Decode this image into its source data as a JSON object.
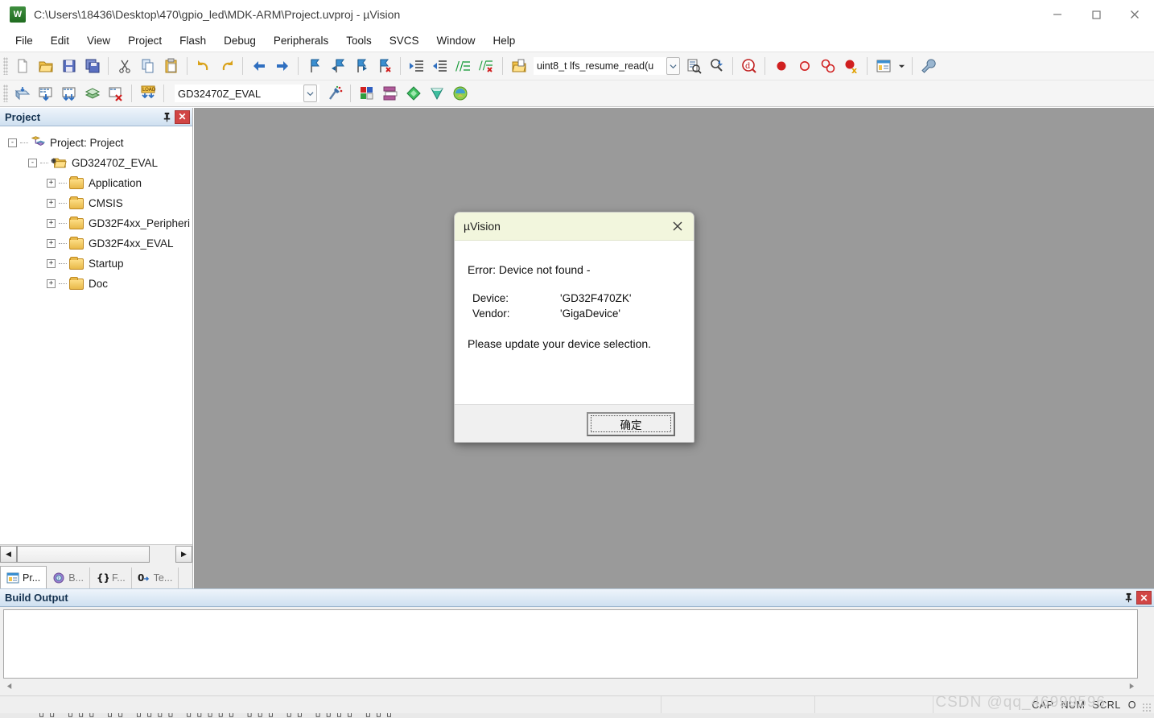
{
  "window": {
    "title": "C:\\Users\\18436\\Desktop\\470\\gpio_led\\MDK-ARM\\Project.uvproj - µVision",
    "app_icon": "uvision-icon",
    "minimize": "–",
    "maximize": "□",
    "close": "✕"
  },
  "menu": {
    "items": [
      {
        "label": "File"
      },
      {
        "label": "Edit"
      },
      {
        "label": "View"
      },
      {
        "label": "Project"
      },
      {
        "label": "Flash"
      },
      {
        "label": "Debug"
      },
      {
        "label": "Peripherals"
      },
      {
        "label": "Tools"
      },
      {
        "label": "SVCS"
      },
      {
        "label": "Window"
      },
      {
        "label": "Help"
      }
    ]
  },
  "toolbar_main": {
    "function_combo_value": "uint8_t lfs_resume_read(u",
    "buttons": [
      {
        "name": "new-file-icon"
      },
      {
        "name": "open-file-icon"
      },
      {
        "name": "save-icon"
      },
      {
        "name": "save-all-icon"
      },
      {
        "name": "cut-icon"
      },
      {
        "name": "copy-icon"
      },
      {
        "name": "paste-icon"
      },
      {
        "name": "undo-icon"
      },
      {
        "name": "redo-icon"
      },
      {
        "name": "navigate-back-icon"
      },
      {
        "name": "navigate-forward-icon"
      },
      {
        "name": "bookmark-toggle-icon"
      },
      {
        "name": "bookmark-previous-icon"
      },
      {
        "name": "bookmark-next-icon"
      },
      {
        "name": "bookmark-clear-icon"
      },
      {
        "name": "indent-right-icon"
      },
      {
        "name": "indent-left-icon"
      },
      {
        "name": "comment-lines-icon"
      },
      {
        "name": "uncomment-lines-icon"
      },
      {
        "name": "open-document-icon"
      },
      {
        "name": "find-in-files-icon"
      },
      {
        "name": "incremental-find-icon"
      },
      {
        "name": "debug-session-icon"
      },
      {
        "name": "breakpoint-insert-icon"
      },
      {
        "name": "breakpoint-disable-icon"
      },
      {
        "name": "breakpoint-disable-all-icon"
      },
      {
        "name": "breakpoint-kill-all-icon"
      },
      {
        "name": "manage-windows-icon"
      },
      {
        "name": "dropdown-arrow-icon"
      },
      {
        "name": "configure-tools-icon"
      }
    ]
  },
  "toolbar_build": {
    "target_combo_value": "GD32470Z_EVAL",
    "buttons": [
      {
        "name": "translate-file-icon"
      },
      {
        "name": "build-target-icon"
      },
      {
        "name": "rebuild-all-icon"
      },
      {
        "name": "batch-build-icon"
      },
      {
        "name": "stop-build-icon"
      },
      {
        "name": "download-to-flash-icon"
      },
      {
        "name": "target-options-icon"
      },
      {
        "name": "manage-project-items-icon"
      },
      {
        "name": "manage-run-time-environment-icon"
      },
      {
        "name": "multi-project-icon"
      },
      {
        "name": "pack-installer-icon"
      },
      {
        "name": "component-manager-icon"
      }
    ]
  },
  "project_panel": {
    "title": "Project",
    "pin_icon": "pin-icon",
    "close_icon": "close-icon",
    "tree": [
      {
        "label": "Project: Project",
        "level": 0,
        "expander": "-",
        "icon": "project-icon"
      },
      {
        "label": "GD32470Z_EVAL",
        "level": 1,
        "expander": "-",
        "icon": "target-folder-icon"
      },
      {
        "label": "Application",
        "level": 2,
        "expander": "+",
        "icon": "folder-icon"
      },
      {
        "label": "CMSIS",
        "level": 2,
        "expander": "+",
        "icon": "folder-icon"
      },
      {
        "label": "GD32F4xx_Peripheri",
        "level": 2,
        "expander": "+",
        "icon": "folder-icon"
      },
      {
        "label": "GD32F4xx_EVAL",
        "level": 2,
        "expander": "+",
        "icon": "folder-icon"
      },
      {
        "label": "Startup",
        "level": 2,
        "expander": "+",
        "icon": "folder-icon"
      },
      {
        "label": "Doc",
        "level": 2,
        "expander": "+",
        "icon": "folder-icon"
      }
    ],
    "scroll_left_arrow": "◀",
    "scroll_right_arrow": "▶",
    "tabs": [
      {
        "label": "Pr...",
        "icon": "project-tab-icon",
        "active": true
      },
      {
        "label": "B...",
        "icon": "books-tab-icon",
        "active": false
      },
      {
        "label": "F...",
        "icon": "functions-tab-icon",
        "active": false
      },
      {
        "label": "Te...",
        "icon": "templates-tab-icon",
        "active": false
      }
    ]
  },
  "dialog": {
    "title": "µVision",
    "close_icon": "close-icon",
    "error_line": "Error: Device not found -",
    "device_label": "Device:",
    "device_value": "'GD32F470ZK'",
    "vendor_label": "Vendor:",
    "vendor_value": "'GigaDevice'",
    "note": "Please update your device selection.",
    "ok_button": "确定"
  },
  "build_output": {
    "title": "Build Output",
    "pin_icon": "pin-icon",
    "close_icon": "close-icon",
    "content": "",
    "scroll_up_arrow": "▲",
    "scroll_down_arrow": "▼",
    "scroll_left_arrow": "◀",
    "scroll_right_arrow": "▶"
  },
  "statusbar": {
    "cells": [
      "",
      "",
      "",
      ""
    ],
    "keys": [
      "CAP",
      "NUM",
      "SCRL",
      "O"
    ]
  },
  "watermark": "CSDN @qq_46999596",
  "colors": {
    "mdi_background": "#9a9a9a",
    "panel_header_start": "#eef4fb",
    "panel_header_end": "#cfe0f0",
    "dialog_title": "#f2f6dd",
    "close_button": "#d14545",
    "accent_text": "#13314f"
  }
}
